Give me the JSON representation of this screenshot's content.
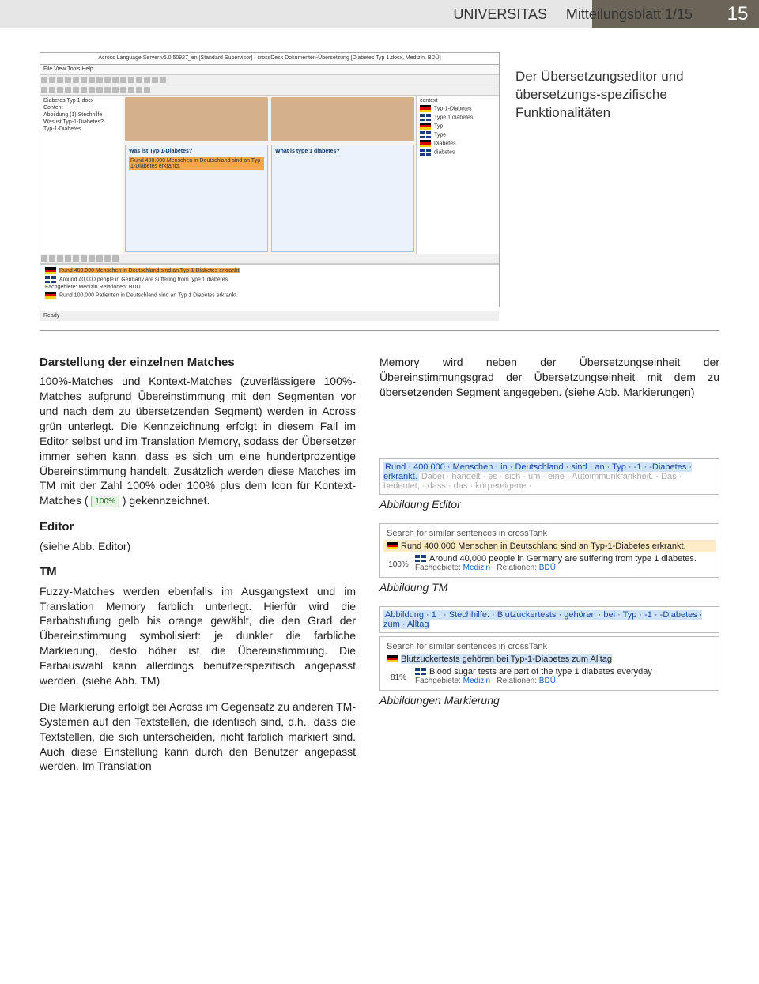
{
  "header": {
    "brand": "UNIVERSITAS",
    "issue": "Mitteilungsblatt 1/15",
    "page": "15"
  },
  "caption": "Der Übersetzungseditor und übersetzungs-spezifische Funktionalitäten",
  "app": {
    "title": "Across Language Server v6.0 50927_en  [Standard Supervisor] - crossDesk Dokumenten-Übersetzung [Diabetes Typ 1.docx, Medizin, BDÜ]",
    "menu": "File   View   Tools   Help",
    "tree": [
      "Diabetes Typ 1.docx",
      "  Content",
      "    Abbildung (1) Stechhilfe",
      "    Was ist Typ-1-Diabetes?",
      "    Typ-1-Diabetes"
    ],
    "source_q": "Was ist Typ-1-Diabetes?",
    "target_q": "What is type 1 diabetes?",
    "source_hl": "Rund 400.000 Menschen in Deutschland sind an Typ-1-Diabetes erkrankt.",
    "context": [
      "context",
      "Typ-1-Diabetes",
      "Type 1 diabetes",
      "Typ",
      "Type",
      "Diabetes",
      "diabetes"
    ],
    "bottom_lines": [
      "Rund 400.000 Menschen in Deutschland sind an Typ-1-Diabetes erkrankt.",
      "Around 40,000 people in Germany are suffering from type 1 diabetes.",
      "Fachgebiete: Medizin  Relationen: BDÜ",
      "Rund 100.000 Patienten in Deutschland sind an Typ 1 Diabetes erkrankt."
    ],
    "status": "Ready"
  },
  "left": {
    "h1": "Darstellung der einzelnen Matches",
    "p1a": "100%-Matches und Kontext-Matches (zuverlässigere 100%-Matches aufgrund Übereinstimmung mit den Segmenten vor und nach dem zu übersetzenden Segment) werden in Across grün unterlegt. Die Kennzeichnung erfolgt in diesem Fall im Editor selbst und im Translation Memory, sodass der Übersetzer immer sehen kann, dass es sich um eine hundertprozentige Übereinstimmung handelt. Zusätzlich werden diese Matches im TM mit der Zahl 100% oder 100% plus dem Icon für Kontext-Matches ( ",
    "icon": "100%",
    "p1b": " ) gekennzeichnet.",
    "h2": "Editor",
    "p2": "(siehe Abb. Editor)",
    "h3": "TM",
    "p3": "Fuzzy-Matches werden ebenfalls im Ausgangstext und im Translation Memory farblich unterlegt. Hierfür wird die Farbabstufung gelb bis orange gewählt, die den Grad der Übereinstimmung symbolisiert: je dunkler die farbliche Markierung, desto höher ist die Übereinstimmung. Die Farbauswahl kann allerdings benutzerspezifisch angepasst werden. (siehe Abb. TM)",
    "p4": "Die Markierung erfolgt bei Across im Gegensatz zu anderen TM-Systemen auf den Textstellen, die identisch sind, d.h., dass die Textstellen, die sich unterscheiden, nicht farblich markiert sind. Auch diese Einstellung kann durch den Benutzer angepasst werden. Im Translation"
  },
  "right": {
    "p1": "Memory wird neben der Übersetzungseinheit der Übereinstimmungsgrad der Übersetzungseinheit mit dem zu übersetzenden Segment angegeben. (siehe Abb. Markierungen)",
    "cap_editor": "Abbildung Editor",
    "cap_tm": "Abbildung TM",
    "cap_mark": "Abbildungen Markierung"
  },
  "fig_editor": {
    "line1": "Rund · 400.000 · Menschen · in · Deutschland · sind · an · Typ · -1 · -Diabetes · erkrankt.",
    "line2": "Dabei · handelt · es · sich · um · eine · Autoimmunkrankheit. · Das · bedeutet, · dass · das · körpereigene ·"
  },
  "fig_tm": {
    "hdr": "Search for similar sentences in crossTank",
    "de": "Rund 400.000 Menschen in Deutschland sind an Typ-1-Diabetes erkrankt.",
    "en": "Around 40,000 people in Germany are suffering from type 1 diabetes.",
    "pct": "100%",
    "sub": "Fachgebiete: Medizin   Relationen: BDÜ"
  },
  "fig_mark1": {
    "text": "Abbildung · 1 : · Stechhilfe: · Blutzuckertests · gehören · bei · Typ · -1 · -Diabetes · zum · Alltag"
  },
  "fig_mark2": {
    "hdr": "Search for similar sentences in crossTank",
    "de": "Blutzuckertests gehören bei Typ-1-Diabetes zum Alltag",
    "en": "Blood sugar tests are part of the type 1 diabetes everyday",
    "pct": "81%",
    "sub": "Fachgebiete: Medizin   Relationen: BDÜ"
  }
}
